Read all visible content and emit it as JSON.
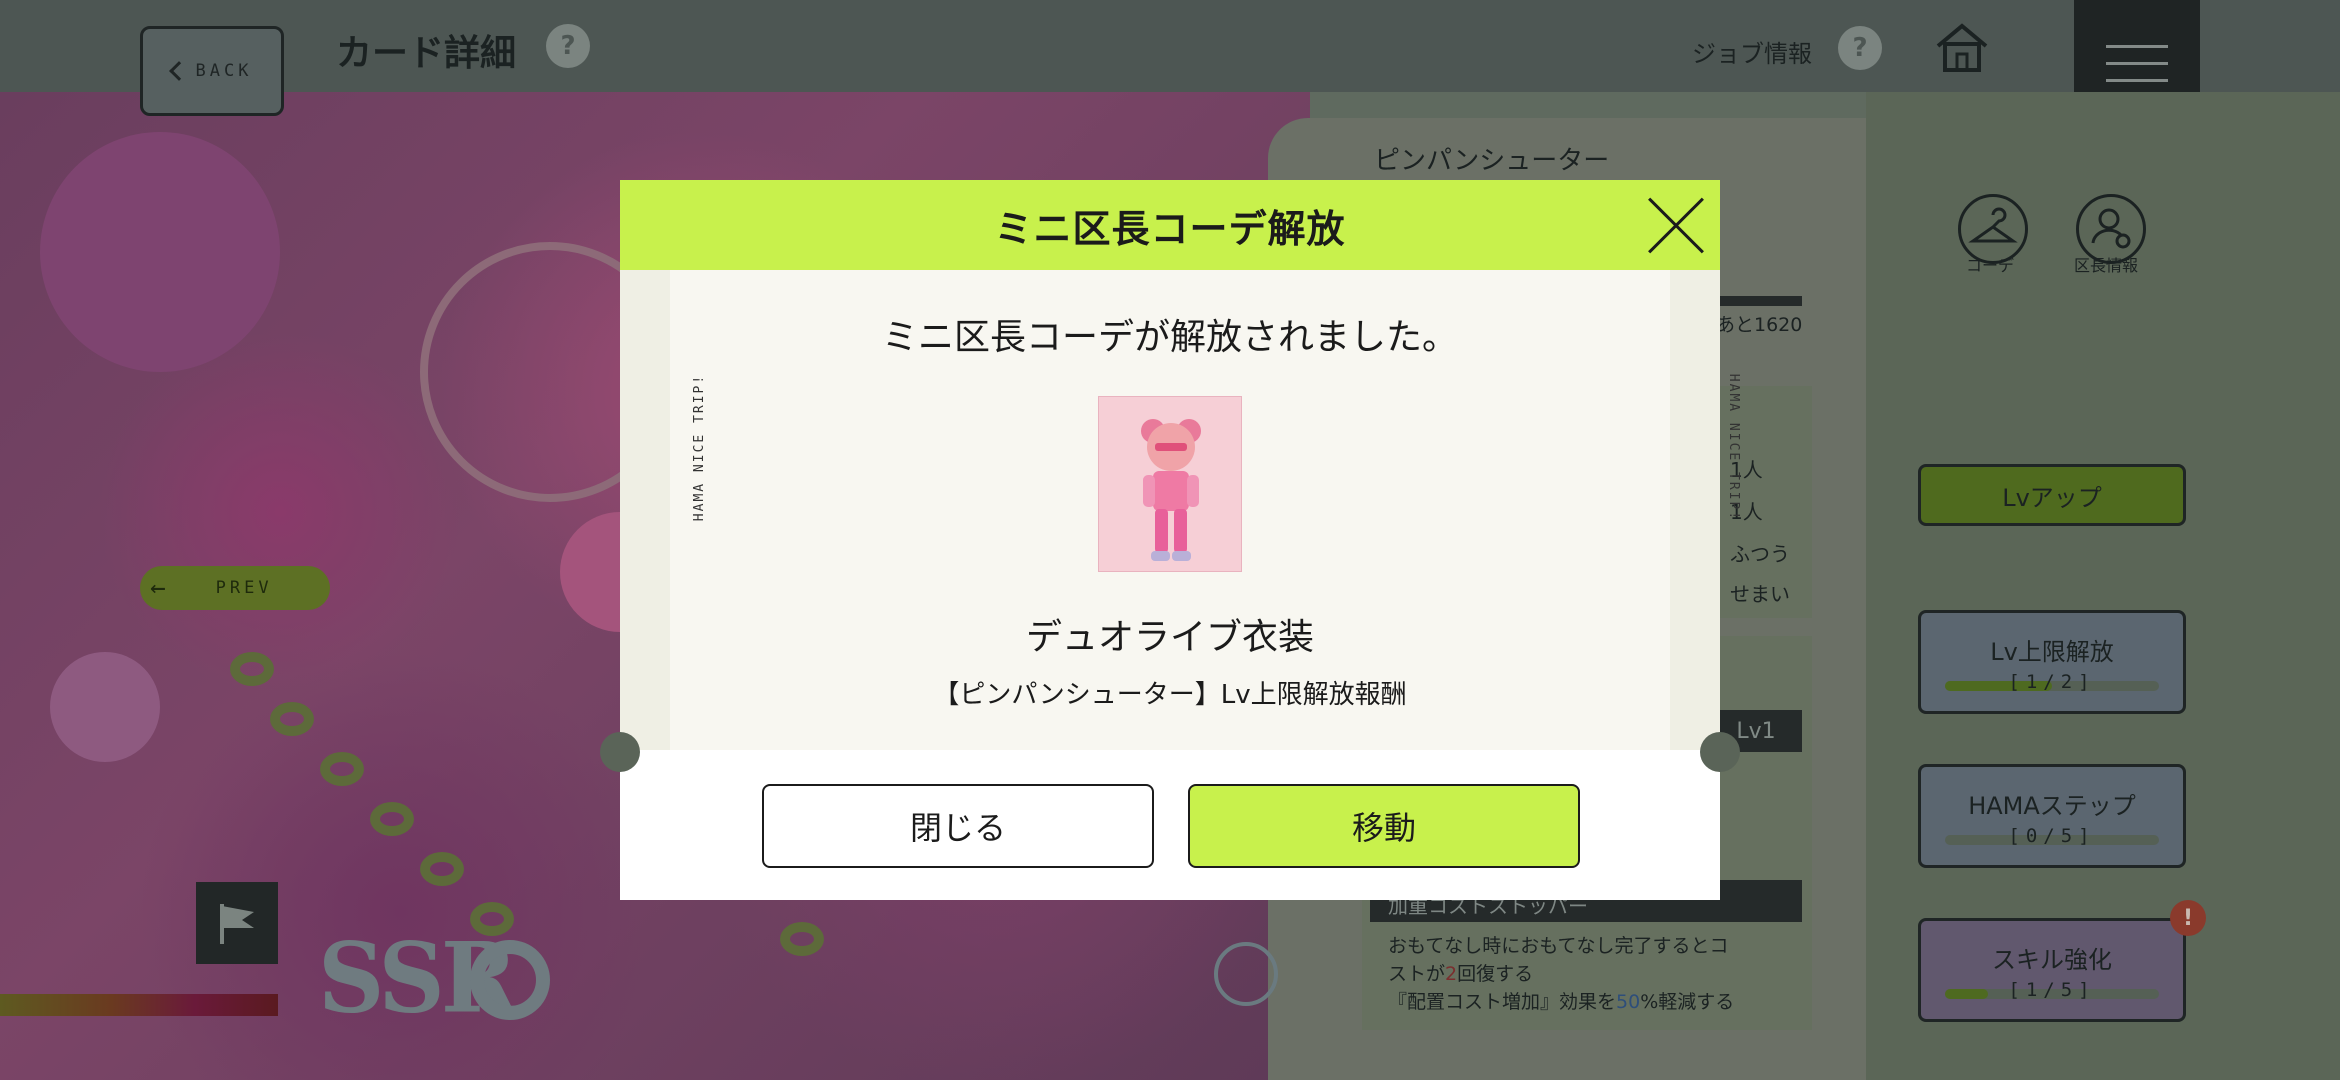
{
  "header": {
    "back_label": "BACK",
    "page_title": "カード詳細",
    "help": "?",
    "job_info_label": "ジョブ情報"
  },
  "card": {
    "job_name": "ピンパンシューター",
    "exp_remaining": "あと1620",
    "prev_label": "PREV",
    "rarity": "SSR",
    "stats": [
      "1人",
      "1人",
      "ふつう",
      "せまい"
    ],
    "skill_level": "Lv1",
    "skill_name": "加重コストストッパー",
    "skill_desc_1": "おもてなし時におもてなし完了するとコ",
    "skill_desc_2": "ストが",
    "skill_desc_num": "2",
    "skill_desc_3": "回復する",
    "skill_desc_4": "『配置コスト増加』効果を",
    "skill_desc_pct": "50",
    "skill_desc_5": "%軽減する"
  },
  "right_icons": {
    "coord_label": "コーデ",
    "ward_info_label": "区長情報"
  },
  "side_buttons": {
    "lv_up": "Lvアップ",
    "limit_break": "Lv上限解放",
    "limit_break_progress": "[1/2]",
    "limit_break_fraction": 0.5,
    "hama_step": "HAMAステップ",
    "hama_step_progress": "[0/5]",
    "hama_step_fraction": 0.0,
    "skill_up": "スキル強化",
    "skill_up_progress": "[1/5]",
    "skill_up_fraction": 0.2,
    "notice_badge": "!"
  },
  "modal": {
    "title": "ミニ区長コーデ解放",
    "message": "ミニ区長コーデが解放されました。",
    "ticket_side_text": "HAMA NICE TRIP!",
    "item_name": "デュオライブ衣装",
    "item_source": "【ピンパンシューター】Lv上限解放報酬",
    "close_button": "閉じる",
    "move_button": "移動"
  },
  "colors": {
    "accent_lime": "#c8f14c",
    "modal_bg": "#ffffff",
    "ticket_bg": "#f8f7f1"
  }
}
